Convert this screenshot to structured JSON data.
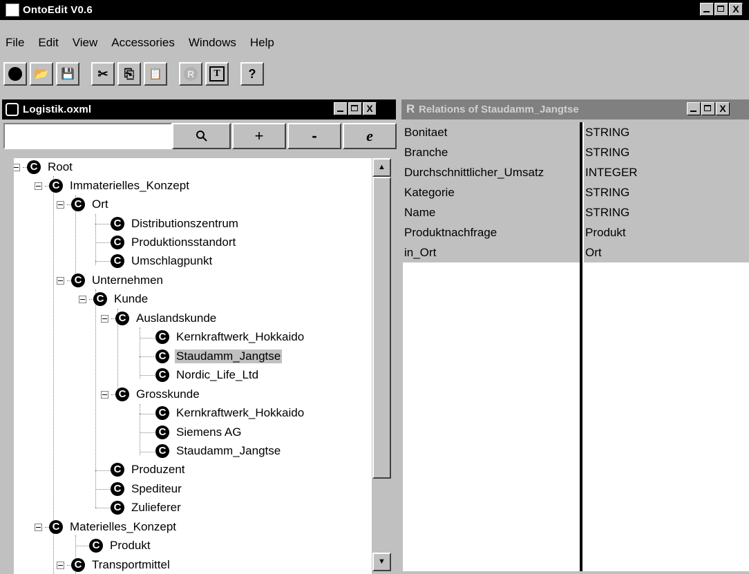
{
  "app": {
    "title": "OntoEdit V0.6",
    "close_glyph": "X"
  },
  "menu": [
    {
      "label": "File"
    },
    {
      "label": "Edit"
    },
    {
      "label": "View"
    },
    {
      "label": "Accessories"
    },
    {
      "label": "Windows"
    },
    {
      "label": "Help"
    }
  ],
  "toolbar": {
    "new": "O",
    "open": "📂",
    "save": "💾",
    "cut": "✂",
    "copy": "⎘",
    "paste": "📋",
    "relation": "R",
    "text": "T",
    "help": "?"
  },
  "ontology_window": {
    "title": "Logistik.oxml",
    "search_value": "",
    "search_icon": "magnifier-icon",
    "add_label": "+",
    "remove_label": "-",
    "e_label": "e",
    "close_glyph": "X",
    "tree": [
      {
        "label": "Root"
      },
      {
        "label": "Immaterielles_Konzept"
      },
      {
        "label": "Ort"
      },
      {
        "label": "Distributionszentrum"
      },
      {
        "label": "Produktionsstandort"
      },
      {
        "label": "Umschlagpunkt"
      },
      {
        "label": "Unternehmen"
      },
      {
        "label": "Kunde"
      },
      {
        "label": "Auslandskunde"
      },
      {
        "label": "Kernkraftwerk_Hokkaido"
      },
      {
        "label": "Staudamm_Jangtse"
      },
      {
        "label": "Nordic_Life_Ltd"
      },
      {
        "label": "Grosskunde"
      },
      {
        "label": "Kernkraftwerk_Hokkaido"
      },
      {
        "label": "Siemens AG"
      },
      {
        "label": "Staudamm_Jangtse"
      },
      {
        "label": "Produzent"
      },
      {
        "label": "Spediteur"
      },
      {
        "label": "Zulieferer"
      },
      {
        "label": "Materielles_Konzept"
      },
      {
        "label": "Produkt"
      },
      {
        "label": "Transportmittel"
      }
    ],
    "node_icon_letter": "C",
    "selected_node": "Staudamm_Jangtse"
  },
  "relations_window": {
    "title": "Relations of Staudamm_Jangtse",
    "icon_letter": "R",
    "close_glyph": "X",
    "rows": [
      {
        "name": "Bonitaet",
        "type": "STRING"
      },
      {
        "name": "Branche",
        "type": "STRING"
      },
      {
        "name": "Durchschnittlicher_Umsatz",
        "type": "INTEGER"
      },
      {
        "name": "Kategorie",
        "type": "STRING"
      },
      {
        "name": "Name",
        "type": "STRING"
      },
      {
        "name": "Produktnachfrage",
        "type": "Produkt"
      },
      {
        "name": "in_Ort",
        "type": "Ort"
      }
    ]
  }
}
